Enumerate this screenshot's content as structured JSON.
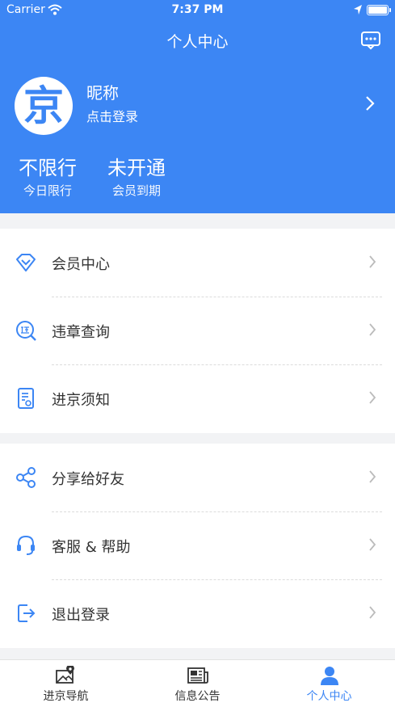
{
  "status": {
    "carrier": "Carrier",
    "time": "7:37 PM"
  },
  "nav": {
    "title": "个人中心",
    "message_icon": "message-icon"
  },
  "profile": {
    "avatar_char": "京",
    "nickname": "昵称",
    "login_hint": "点击登录"
  },
  "stats": [
    {
      "value": "不限行",
      "label": "今日限行"
    },
    {
      "value": "未开通",
      "label": "会员到期"
    }
  ],
  "menu1": [
    {
      "label": "会员中心",
      "icon": "diamond-icon"
    },
    {
      "label": "违章查询",
      "icon": "violation-search-icon"
    },
    {
      "label": "进京须知",
      "icon": "document-icon"
    }
  ],
  "menu2": [
    {
      "label": "分享给好友",
      "icon": "share-icon"
    },
    {
      "label": "客服 & 帮助",
      "icon": "headset-icon"
    },
    {
      "label": "退出登录",
      "icon": "logout-icon"
    }
  ],
  "tabs": [
    {
      "label": "进京导航",
      "icon": "map-icon",
      "active": false
    },
    {
      "label": "信息公告",
      "icon": "newspaper-icon",
      "active": false
    },
    {
      "label": "个人中心",
      "icon": "user-icon",
      "active": true
    }
  ],
  "colors": {
    "primary": "#3c86f4",
    "background": "#f2f3f5"
  }
}
